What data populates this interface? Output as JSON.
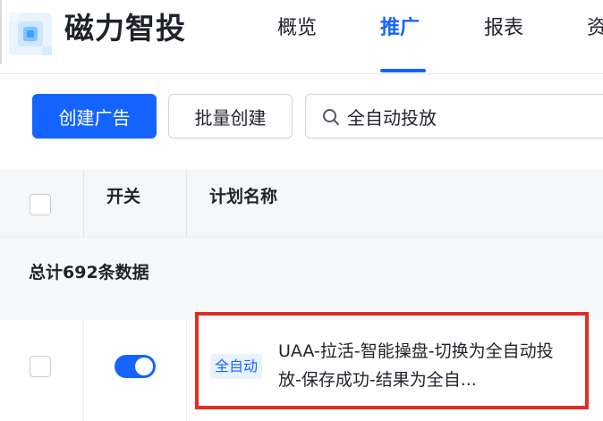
{
  "header": {
    "app_title": "磁力智投",
    "nav": [
      {
        "label": "概览"
      },
      {
        "label": "推广",
        "active": true
      },
      {
        "label": "报表"
      },
      {
        "label": "资"
      }
    ]
  },
  "toolbar": {
    "create_label": "创建广告",
    "batch_label": "批量创建",
    "search_value": "全自动投放"
  },
  "table": {
    "headers": [
      "开关",
      "计划名称"
    ],
    "summary": "总计692条数据",
    "rows": [
      {
        "switch_on": true,
        "tag": "全自动",
        "name": "UAA-拉活-智能操盘-切换为全自动投放-保存成功-结果为全自..."
      }
    ]
  },
  "colors": {
    "accent": "#1664ff",
    "highlight": "#e02e24",
    "tag_bg": "#e8f3ff"
  }
}
